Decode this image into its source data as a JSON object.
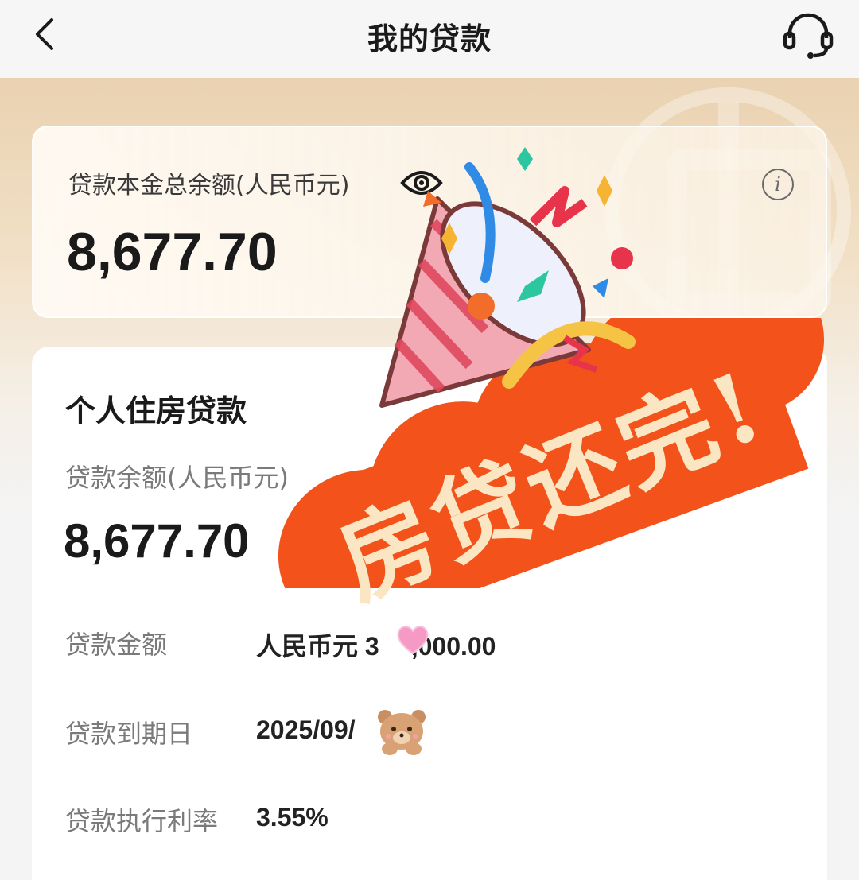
{
  "navbar": {
    "title": "我的贷款",
    "back_icon": "chevron-left-icon",
    "support_icon": "headset-icon"
  },
  "summary": {
    "label": "贷款本金总余额(人民币元)",
    "amount": "8,677.70",
    "visibility_icon": "eye-icon",
    "info_icon": "info-icon",
    "info_glyph": "i"
  },
  "loan": {
    "type": "个人住房贷款",
    "balance_label": "贷款余额(人民币元)",
    "balance_amount": "8,677.70",
    "details": [
      {
        "label": "贷款金额",
        "value": "人民币元 3"
      },
      {
        "label": "贷款到期日",
        "value": "2025/09/"
      },
      {
        "label": "贷款执行利率",
        "value": "3.55%"
      }
    ],
    "amount_tail": ",000.00"
  },
  "overlay": {
    "text": "房贷还完!"
  },
  "colors": {
    "banner": "#f3521a",
    "banner_text": "#fbe6c4",
    "header_gradient_top": "#ead2b1"
  }
}
